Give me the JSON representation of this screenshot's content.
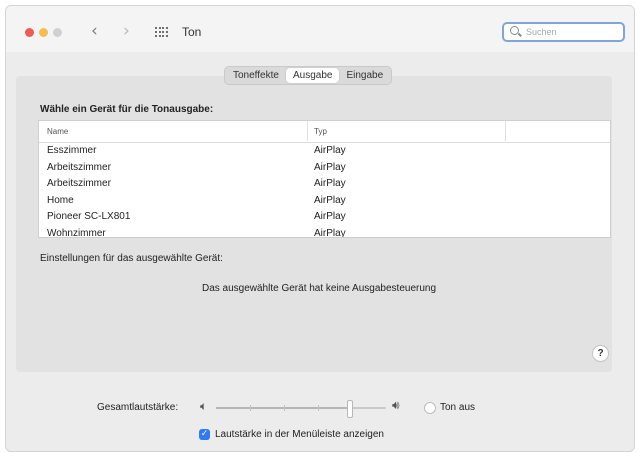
{
  "window": {
    "title": "Ton"
  },
  "toolbar": {
    "back": "‹",
    "forward": "›"
  },
  "search": {
    "placeholder": "Suchen"
  },
  "tabs": [
    {
      "label": "Toneffekte",
      "active": false
    },
    {
      "label": "Ausgabe",
      "active": true
    },
    {
      "label": "Eingabe",
      "active": false
    }
  ],
  "output": {
    "choose_label": "Wähle ein Gerät für die Tonausgabe:",
    "columns": {
      "name": "Name",
      "type": "Typ"
    },
    "devices": [
      {
        "name": "Esszimmer",
        "type": "AirPlay"
      },
      {
        "name": "Arbeitszimmer",
        "type": "AirPlay"
      },
      {
        "name": "Arbeitszimmer",
        "type": "AirPlay"
      },
      {
        "name": "Home",
        "type": "AirPlay"
      },
      {
        "name": "Pioneer SC-LX801",
        "type": "AirPlay"
      },
      {
        "name": "Wohnzimmer",
        "type": "AirPlay"
      }
    ],
    "settings_label": "Einstellungen für das ausgewählte Gerät:",
    "no_controls": "Das ausgewählte Gerät hat keine Ausgabesteuerung"
  },
  "help": {
    "label": "?"
  },
  "volume": {
    "label": "Gesamtlautstärke:",
    "level": 0.78,
    "mute_label": "Ton aus",
    "mute_checked": false
  },
  "menubar": {
    "label": "Lautstärke in der Menüleiste anzeigen",
    "checked": true
  },
  "colors": {
    "accent": "#2f7bf5",
    "close": "#ee5a55",
    "minimize": "#f5bd4f"
  }
}
